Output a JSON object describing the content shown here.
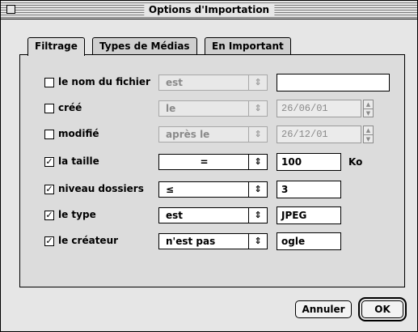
{
  "window": {
    "title": "Options d'Importation"
  },
  "tabs": [
    {
      "label": "Filtrage"
    },
    {
      "label": "Types de Médias"
    },
    {
      "label": "En Important"
    }
  ],
  "filters": [
    {
      "label": "le nom du fichier",
      "checked": false,
      "enabled": false,
      "operator": "est",
      "value": ""
    },
    {
      "label": "créé",
      "checked": false,
      "enabled": false,
      "operator": "le",
      "value": "26/06/01"
    },
    {
      "label": "modifié",
      "checked": false,
      "enabled": false,
      "operator": "après le",
      "value": "26/12/01"
    },
    {
      "label": "la taille",
      "checked": true,
      "enabled": true,
      "operator": "=",
      "value": "100",
      "unit": "Ko"
    },
    {
      "label": "niveau dossiers",
      "checked": true,
      "enabled": true,
      "operator": "≤",
      "value": "3"
    },
    {
      "label": "le type",
      "checked": true,
      "enabled": true,
      "operator": "est",
      "value": "JPEG"
    },
    {
      "label": "le créateur",
      "checked": true,
      "enabled": true,
      "operator": "n'est pas",
      "value": "ogle"
    }
  ],
  "buttons": {
    "cancel": "Annuler",
    "ok": "OK"
  },
  "glyphs": {
    "check": "✓",
    "popup_arrows": "⇕",
    "step_up": "▲",
    "step_down": "▼"
  }
}
